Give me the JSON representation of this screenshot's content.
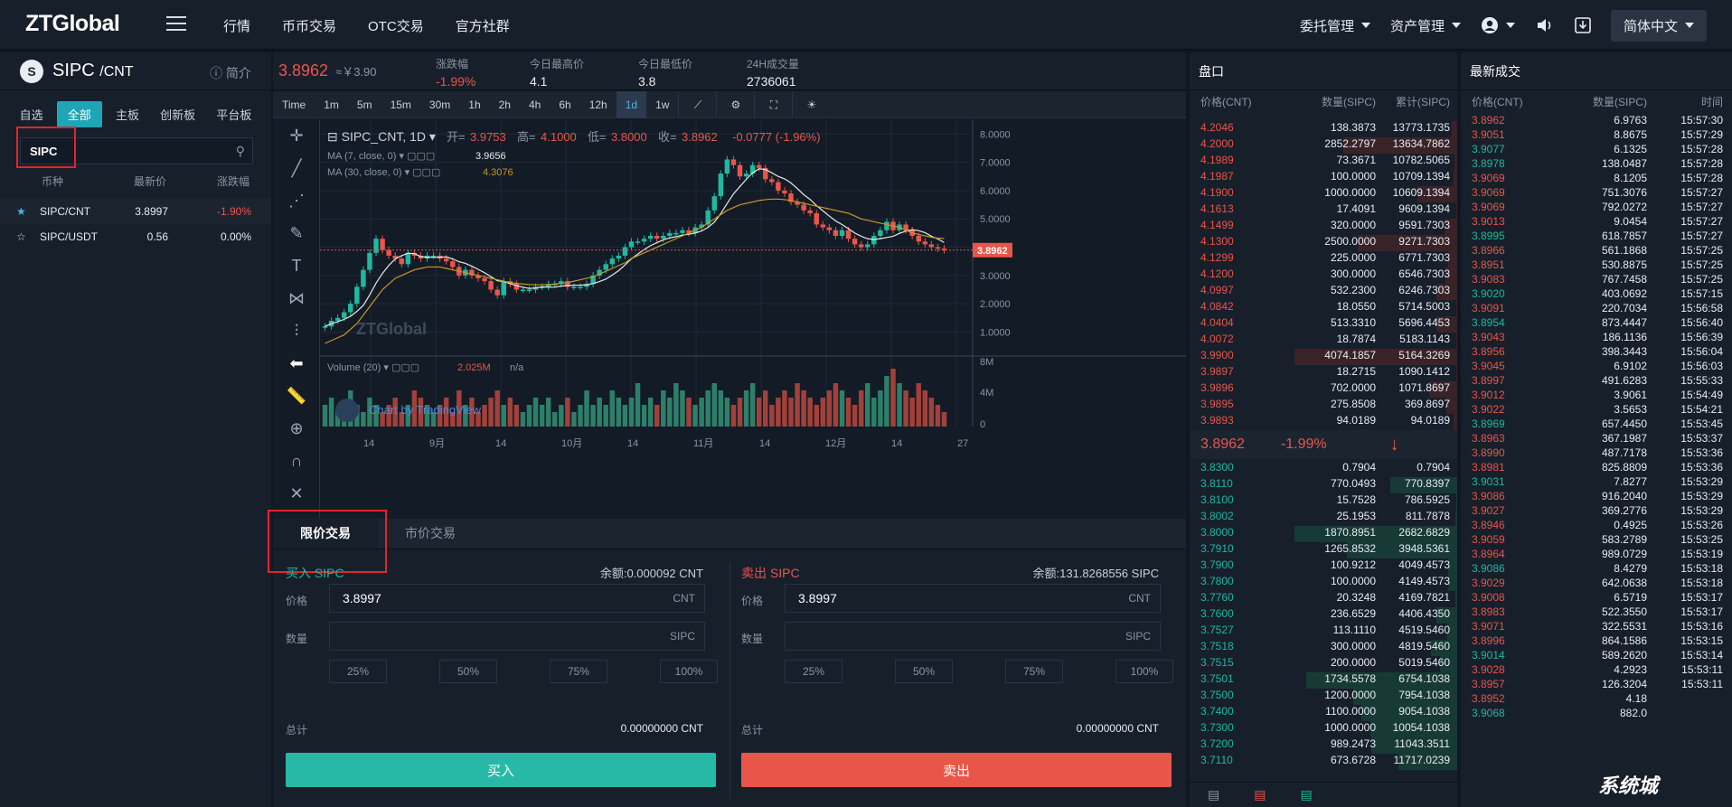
{
  "topbar": {
    "logo": "ZTGlobal",
    "nav": [
      "行情",
      "币币交易",
      "OTC交易",
      "官方社群"
    ],
    "orders": "委托管理",
    "assets": "资产管理",
    "lang": "简体中文"
  },
  "pair": {
    "symbol": "SIPC",
    "quote": "/CNT",
    "intro": "简介",
    "last": "3.8962",
    "cny": "≈￥3.90",
    "change_label": "涨跌幅",
    "change": "-1.99%",
    "high_label": "今日最高价",
    "high": "4.1",
    "low_label": "今日最低价",
    "low": "3.8",
    "vol_label": "24H成交量",
    "vol": "2736061"
  },
  "market": {
    "tabs": [
      "自选",
      "全部",
      "主板",
      "创新板",
      "平台板"
    ],
    "active_tab": "全部",
    "search_value": "SIPC",
    "headers": [
      "币种",
      "最新价",
      "涨跌幅"
    ],
    "rows": [
      {
        "star": "★",
        "name": "SIPC/CNT",
        "price": "3.8997",
        "change": "-1.90%",
        "color": "#e8564a"
      },
      {
        "star": "☆",
        "name": "SIPC/USDT",
        "price": "0.56",
        "change": "0.00%",
        "color": "#e7ecf2"
      }
    ]
  },
  "chart_toolbar": [
    "Time",
    "1m",
    "5m",
    "15m",
    "30m",
    "1h",
    "2h",
    "4h",
    "6h",
    "12h",
    "1d",
    "1w"
  ],
  "chart_toolbar_selected": "1d",
  "chart_legend": {
    "title": "SIPC_CNT, 1D",
    "open_label": "开=",
    "open": "3.9753",
    "high_label": "高=",
    "high": "4.1000",
    "low_label": "低=",
    "low": "3.8000",
    "close_label": "收=",
    "close": "3.8962",
    "delta": "-0.0777 (-1.96%)",
    "ma7_label": "MA (7, close, 0)",
    "ma7": "3.9656",
    "ma30_label": "MA (30, close, 0)",
    "ma30": "4.3076",
    "volume_label": "Volume (20)",
    "volume": "2.025M",
    "volume_ma": "n/a",
    "watermark": "ZTGlobal",
    "tv_credit": "Chart by TradingView",
    "price_tag": "3.8962"
  },
  "chart_data": {
    "type": "candlestick",
    "y_ticks": [
      "8.0000",
      "7.0000",
      "6.0000",
      "5.0000",
      "4.0000",
      "3.0000",
      "2.0000",
      "1.0000"
    ],
    "volume_ticks": [
      "8M",
      "4M",
      "0"
    ],
    "x_ticks": [
      "14",
      "9月",
      "14",
      "10月",
      "14",
      "11月",
      "14",
      "12月",
      "14",
      "27"
    ],
    "close_series": [
      1.2,
      1.4,
      1.5,
      1.7,
      2.0,
      2.6,
      3.2,
      3.8,
      4.3,
      3.9,
      3.7,
      3.6,
      3.4,
      3.8,
      3.7,
      3.6,
      3.7,
      3.7,
      3.6,
      3.5,
      3.3,
      3.0,
      3.2,
      3.0,
      2.9,
      2.8,
      2.5,
      2.3,
      2.8,
      2.7,
      2.5,
      2.5,
      2.5,
      2.6,
      2.6,
      2.7,
      2.7,
      2.8,
      2.6,
      2.6,
      2.6,
      2.7,
      3.0,
      3.2,
      3.4,
      3.6,
      3.7,
      4.0,
      4.2,
      4.2,
      4.3,
      4.4,
      4.3,
      4.4,
      4.5,
      4.5,
      4.6,
      4.5,
      4.7,
      4.8,
      5.3,
      5.8,
      6.6,
      7.1,
      6.9,
      6.5,
      6.6,
      6.9,
      6.8,
      6.4,
      6.3,
      6.0,
      5.9,
      5.6,
      5.5,
      5.3,
      5.2,
      4.8,
      4.7,
      4.6,
      4.4,
      4.6,
      4.3,
      4.1,
      4.0,
      4.1,
      4.4,
      4.6,
      4.9,
      4.6,
      4.8,
      4.6,
      4.4,
      4.2,
      4.1,
      4.0,
      3.95,
      3.9
    ],
    "ma30_series": [
      0.6,
      0.7,
      0.8,
      0.9,
      1.1,
      1.3,
      1.6,
      1.9,
      2.2,
      2.5,
      2.7,
      2.9,
      3.0,
      3.1,
      3.2,
      3.25,
      3.3,
      3.3,
      3.3,
      3.25,
      3.2,
      3.15,
      3.1,
      3.05,
      3.0,
      2.95,
      2.9,
      2.85,
      2.8,
      2.75,
      2.72,
      2.7,
      2.68,
      2.67,
      2.67,
      2.68,
      2.7,
      2.72,
      2.75,
      2.8,
      2.85,
      2.9,
      2.95,
      3.05,
      3.15,
      3.25,
      3.35,
      3.45,
      3.6,
      3.7,
      3.8,
      3.9,
      4.0,
      4.1,
      4.2,
      4.3,
      4.4,
      4.5,
      4.6,
      4.7,
      4.85,
      5.0,
      5.15,
      5.3,
      5.4,
      5.5,
      5.55,
      5.6,
      5.65,
      5.68,
      5.7,
      5.7,
      5.68,
      5.65,
      5.6,
      5.55,
      5.5,
      5.45,
      5.4,
      5.35,
      5.3,
      5.25,
      5.2,
      5.1,
      5.0,
      4.95,
      4.9,
      4.85,
      4.8,
      4.75,
      4.7,
      4.6,
      4.5,
      4.45,
      4.4,
      4.35,
      4.32,
      4.31
    ],
    "volume_series": [
      3,
      4,
      2,
      3,
      5,
      3,
      2,
      4,
      3,
      2,
      3,
      4,
      2,
      3,
      5,
      4,
      3,
      2,
      3,
      4,
      2,
      5,
      3,
      4,
      2,
      3,
      4,
      5,
      3,
      4,
      3,
      2,
      3,
      4,
      3,
      4,
      2,
      3,
      4,
      2,
      3,
      5,
      3,
      4,
      3,
      5,
      4,
      3,
      4,
      6,
      3,
      4,
      3,
      5,
      4,
      6,
      5,
      4,
      3,
      4,
      5,
      6,
      5,
      4,
      3,
      4,
      5,
      6,
      4,
      5,
      3,
      4,
      5,
      4,
      6,
      5,
      4,
      3,
      4,
      5,
      6,
      5,
      4,
      3,
      5,
      6,
      4,
      5,
      7,
      8,
      6,
      5,
      4,
      6,
      5,
      4,
      3,
      2
    ]
  },
  "order_form": {
    "tabs": [
      "限价交易",
      "市价交易"
    ],
    "buy": {
      "title": "买入 SIPC",
      "balance": "余额:0.000092 CNT",
      "price_label": "价格",
      "price": "3.8997",
      "price_unit": "CNT",
      "qty_label": "数量",
      "qty_unit": "SIPC",
      "pcts": [
        "25%",
        "50%",
        "75%",
        "100%"
      ],
      "total_label": "总计",
      "total": "0.00000000 CNT",
      "button": "买入"
    },
    "sell": {
      "title": "卖出 SIPC",
      "balance": "余额:131.8268556 SIPC",
      "price_label": "价格",
      "price": "3.8997",
      "price_unit": "CNT",
      "qty_label": "数量",
      "qty_unit": "SIPC",
      "pcts": [
        "25%",
        "50%",
        "75%",
        "100%"
      ],
      "total_label": "总计",
      "total": "0.00000000 CNT",
      "button": "卖出"
    }
  },
  "orderbook": {
    "title": "盘口",
    "headers": [
      "价格(CNT)",
      "数量(SIPC)",
      "累计(SIPC)"
    ],
    "asks": [
      [
        "4.2046",
        "138.3873",
        "13773.1735"
      ],
      [
        "4.2000",
        "2852.2797",
        "13634.7862"
      ],
      [
        "4.1989",
        "73.3671",
        "10782.5065"
      ],
      [
        "4.1987",
        "100.0000",
        "10709.1394"
      ],
      [
        "4.1900",
        "1000.0000",
        "10609.1394"
      ],
      [
        "4.1613",
        "17.4091",
        "9609.1394"
      ],
      [
        "4.1499",
        "320.0000",
        "9591.7303"
      ],
      [
        "4.1300",
        "2500.0000",
        "9271.7303"
      ],
      [
        "4.1299",
        "225.0000",
        "6771.7303"
      ],
      [
        "4.1200",
        "300.0000",
        "6546.7303"
      ],
      [
        "4.0997",
        "532.2300",
        "6246.7303"
      ],
      [
        "4.0842",
        "18.0550",
        "5714.5003"
      ],
      [
        "4.0404",
        "513.3310",
        "5696.4453"
      ],
      [
        "4.0072",
        "18.7874",
        "5183.1143"
      ],
      [
        "3.9900",
        "4074.1857",
        "5164.3269"
      ],
      [
        "3.9897",
        "18.2715",
        "1090.1412"
      ],
      [
        "3.9896",
        "702.0000",
        "1071.8697"
      ],
      [
        "3.9895",
        "275.8508",
        "369.8697"
      ],
      [
        "3.9893",
        "94.0189",
        "94.0189"
      ]
    ],
    "last": "3.8962",
    "last_change": "-1.99%",
    "bids": [
      [
        "3.8300",
        "0.7904",
        "0.7904"
      ],
      [
        "3.8110",
        "770.0493",
        "770.8397"
      ],
      [
        "3.8100",
        "15.7528",
        "786.5925"
      ],
      [
        "3.8002",
        "25.1953",
        "811.7878"
      ],
      [
        "3.8000",
        "1870.8951",
        "2682.6829"
      ],
      [
        "3.7910",
        "1265.8532",
        "3948.5361"
      ],
      [
        "3.7900",
        "100.9212",
        "4049.4573"
      ],
      [
        "3.7800",
        "100.0000",
        "4149.4573"
      ],
      [
        "3.7760",
        "20.3248",
        "4169.7821"
      ],
      [
        "3.7600",
        "236.6529",
        "4406.4350"
      ],
      [
        "3.7527",
        "113.1110",
        "4519.5460"
      ],
      [
        "3.7518",
        "300.0000",
        "4819.5460"
      ],
      [
        "3.7515",
        "200.0000",
        "5019.5460"
      ],
      [
        "3.7501",
        "1734.5578",
        "6754.1038"
      ],
      [
        "3.7500",
        "1200.0000",
        "7954.1038"
      ],
      [
        "3.7400",
        "1100.0000",
        "9054.1038"
      ],
      [
        "3.7300",
        "1000.0000",
        "10054.1038"
      ],
      [
        "3.7200",
        "989.2473",
        "11043.3511"
      ],
      [
        "3.7110",
        "673.6728",
        "11717.0239"
      ]
    ]
  },
  "trades": {
    "title": "最新成交",
    "headers": [
      "价格(CNT)",
      "数量(SIPC)",
      "时间"
    ],
    "rows": [
      [
        "3.8962",
        "6.9763",
        "15:57:30",
        "r"
      ],
      [
        "3.9051",
        "8.8675",
        "15:57:29",
        "r"
      ],
      [
        "3.9077",
        "6.1325",
        "15:57:28",
        "g"
      ],
      [
        "3.8978",
        "138.0487",
        "15:57:28",
        "g"
      ],
      [
        "3.9069",
        "8.1205",
        "15:57:28",
        "r"
      ],
      [
        "3.9069",
        "751.3076",
        "15:57:27",
        "r"
      ],
      [
        "3.9069",
        "792.0272",
        "15:57:27",
        "r"
      ],
      [
        "3.9013",
        "9.0454",
        "15:57:27",
        "r"
      ],
      [
        "3.8995",
        "618.7857",
        "15:57:27",
        "g"
      ],
      [
        "3.8966",
        "561.1868",
        "15:57:25",
        "r"
      ],
      [
        "3.8951",
        "530.8875",
        "15:57:25",
        "r"
      ],
      [
        "3.9083",
        "767.7458",
        "15:57:25",
        "r"
      ],
      [
        "3.9020",
        "403.0692",
        "15:57:15",
        "g"
      ],
      [
        "3.9091",
        "220.7034",
        "15:56:58",
        "r"
      ],
      [
        "3.8954",
        "873.4447",
        "15:56:40",
        "g"
      ],
      [
        "3.9043",
        "186.1136",
        "15:56:39",
        "r"
      ],
      [
        "3.8956",
        "398.3443",
        "15:56:04",
        "r"
      ],
      [
        "3.9045",
        "6.9102",
        "15:56:03",
        "r"
      ],
      [
        "3.8997",
        "491.6283",
        "15:55:33",
        "r"
      ],
      [
        "3.9012",
        "3.9061",
        "15:54:49",
        "r"
      ],
      [
        "3.9022",
        "3.5653",
        "15:54:21",
        "r"
      ],
      [
        "3.8969",
        "657.4450",
        "15:53:45",
        "g"
      ],
      [
        "3.8963",
        "367.1987",
        "15:53:37",
        "r"
      ],
      [
        "3.8990",
        "487.7178",
        "15:53:36",
        "r"
      ],
      [
        "3.8981",
        "825.8809",
        "15:53:36",
        "r"
      ],
      [
        "3.9031",
        "7.8277",
        "15:53:29",
        "g"
      ],
      [
        "3.9086",
        "916.2040",
        "15:53:29",
        "r"
      ],
      [
        "3.9027",
        "369.2776",
        "15:53:29",
        "r"
      ],
      [
        "3.8946",
        "0.4925",
        "15:53:26",
        "r"
      ],
      [
        "3.9059",
        "583.2789",
        "15:53:25",
        "r"
      ],
      [
        "3.8964",
        "989.0729",
        "15:53:19",
        "r"
      ],
      [
        "3.9086",
        "8.4279",
        "15:53:18",
        "g"
      ],
      [
        "3.9029",
        "642.0638",
        "15:53:18",
        "r"
      ],
      [
        "3.9008",
        "6.5719",
        "15:53:17",
        "r"
      ],
      [
        "3.8983",
        "522.3550",
        "15:53:17",
        "r"
      ],
      [
        "3.9071",
        "322.5531",
        "15:53:16",
        "r"
      ],
      [
        "3.8996",
        "864.1586",
        "15:53:15",
        "r"
      ],
      [
        "3.9014",
        "589.2620",
        "15:53:14",
        "g"
      ],
      [
        "3.9028",
        "4.2923",
        "15:53:11",
        "r"
      ],
      [
        "3.8957",
        "126.3204",
        "15:53:11",
        "r"
      ],
      [
        "3.8952",
        "4.18",
        "",
        "r"
      ],
      [
        "3.9068",
        "882.0",
        "",
        "g"
      ]
    ]
  },
  "colors": {
    "red": "#e8564a",
    "green": "#1fb8a0",
    "accent": "#1fa6b6"
  },
  "corner_watermark": "系统城"
}
